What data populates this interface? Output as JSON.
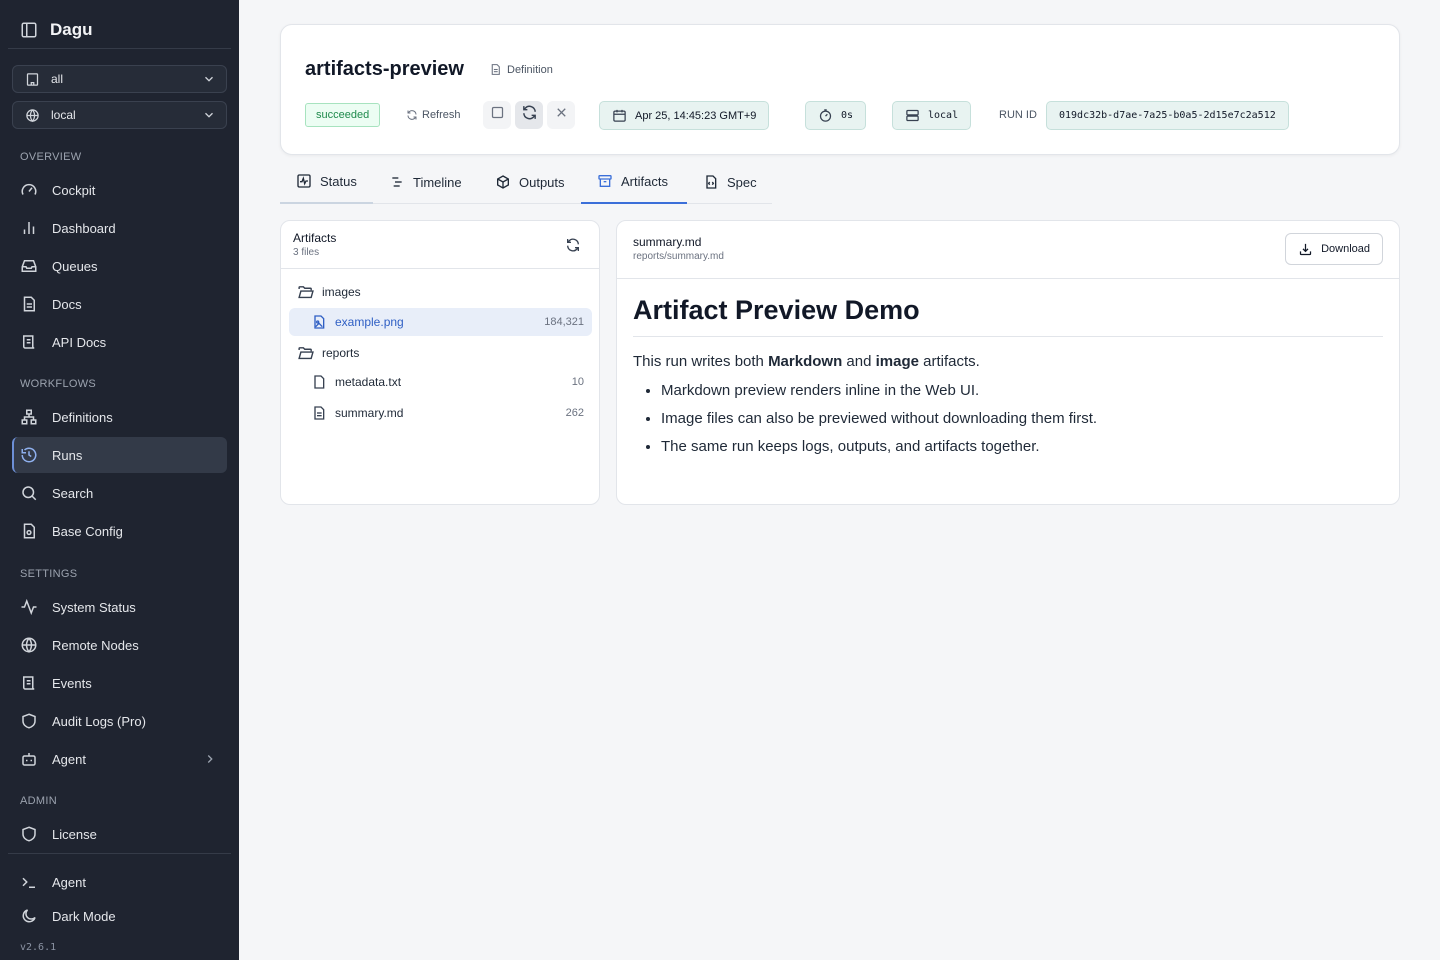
{
  "sidebar": {
    "brand": "Dagu",
    "selects": [
      {
        "value": "all",
        "icon": "building-icon"
      },
      {
        "value": "local",
        "icon": "globe-icon"
      }
    ],
    "sections": {
      "overview": "OVERVIEW",
      "workflows": "WORKFLOWS",
      "settings": "SETTINGS",
      "admin": "ADMIN"
    },
    "items": [
      {
        "label": "Cockpit"
      },
      {
        "label": "Dashboard"
      },
      {
        "label": "Queues"
      },
      {
        "label": "Docs"
      },
      {
        "label": "API Docs"
      },
      {
        "label": "Definitions"
      },
      {
        "label": "Runs"
      },
      {
        "label": "Search"
      },
      {
        "label": "Base Config"
      },
      {
        "label": "System Status"
      },
      {
        "label": "Remote Nodes"
      },
      {
        "label": "Events"
      },
      {
        "label": "Audit Logs (Pro)"
      },
      {
        "label": "Agent"
      },
      {
        "label": "License"
      }
    ],
    "footer": {
      "agent": "Agent",
      "dark_mode": "Dark Mode",
      "version": "v2.6.1"
    }
  },
  "header": {
    "title": "artifacts-preview",
    "definition_link": "Definition",
    "status": "succeeded",
    "refresh": "Refresh",
    "started_at": "Apr 25, 14:45:23 GMT+9",
    "duration": "0s",
    "node": "local",
    "run_id_label": "RUN ID",
    "run_id": "019dc32b-d7ae-7a25-b0a5-2d15e7c2a512"
  },
  "tabs": [
    {
      "label": "Status"
    },
    {
      "label": "Timeline"
    },
    {
      "label": "Outputs"
    },
    {
      "label": "Artifacts"
    },
    {
      "label": "Spec"
    }
  ],
  "artifacts": {
    "title": "Artifacts",
    "count": "3 files",
    "tree": [
      {
        "type": "folder",
        "name": "images"
      },
      {
        "type": "file",
        "name": "example.png",
        "size": "184,321"
      },
      {
        "type": "folder",
        "name": "reports"
      },
      {
        "type": "file",
        "name": "metadata.txt",
        "size": "10"
      },
      {
        "type": "file",
        "name": "summary.md",
        "size": "262"
      }
    ]
  },
  "preview": {
    "file_name": "summary.md",
    "file_path": "reports/summary.md",
    "download": "Download",
    "heading": "Artifact Preview Demo",
    "intro_before": "This run writes both ",
    "intro_bold1": "Markdown",
    "intro_mid": " and ",
    "intro_bold2": "image",
    "intro_after": " artifacts.",
    "bullets": [
      "Markdown preview renders inline in the Web UI.",
      "Image files can also be previewed without downloading them first.",
      "The same run keeps logs, outputs, and artifacts together."
    ]
  },
  "colors": {
    "sidebar_bg": "#1f2430",
    "accent": "#3b6fd9",
    "success": "#1f8a4c"
  }
}
